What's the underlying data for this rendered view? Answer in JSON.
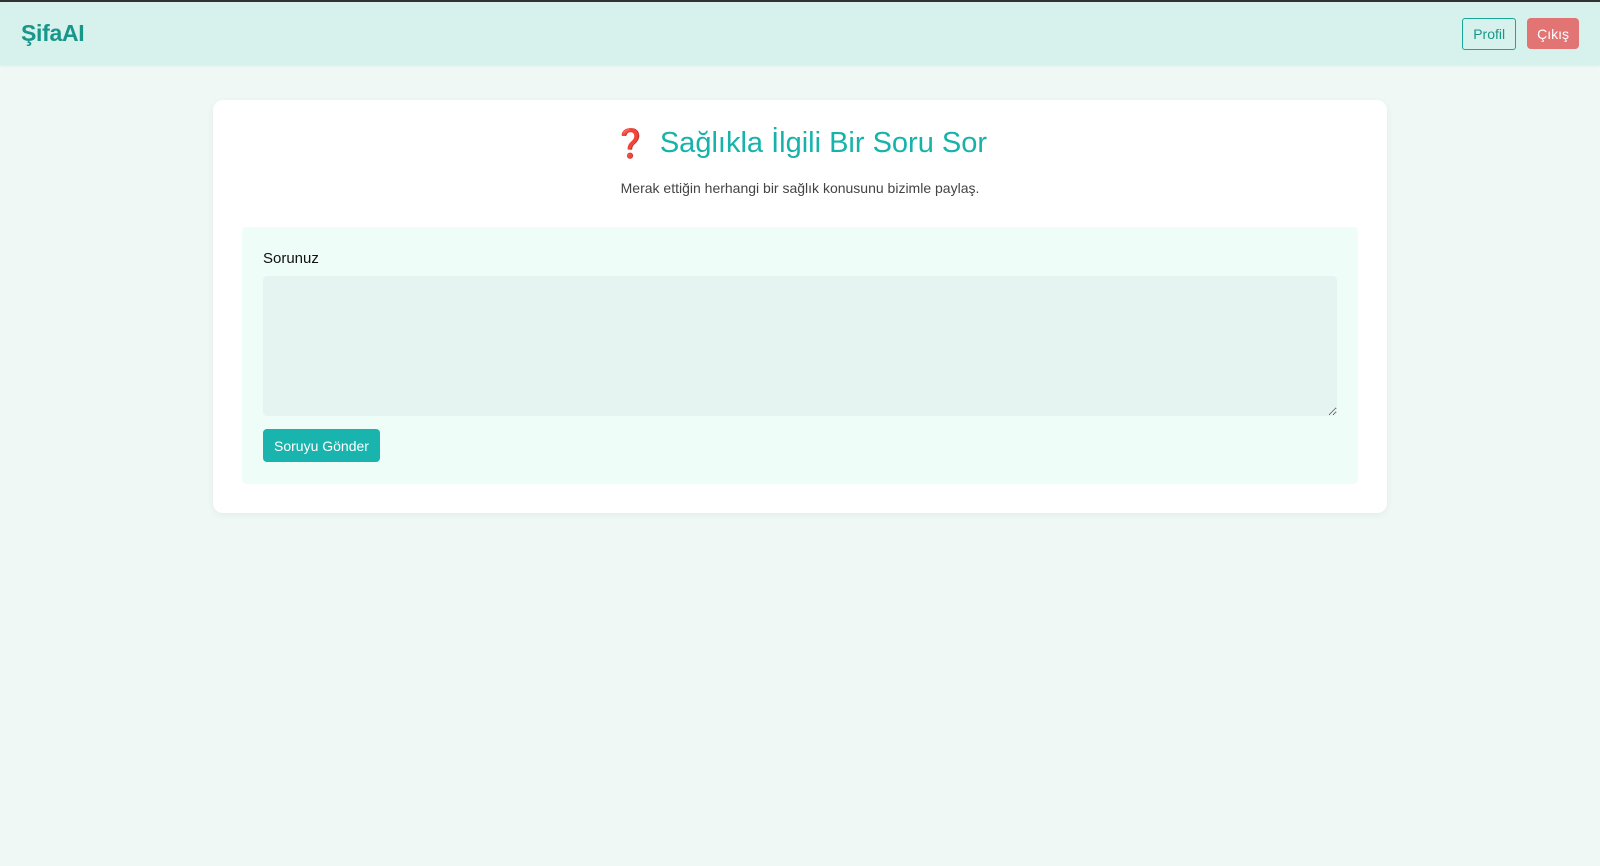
{
  "navbar": {
    "brand": "ŞifaAI",
    "profile_label": "Profil",
    "logout_label": "Çıkış"
  },
  "main": {
    "title_icon": "❓",
    "title": "Sağlıkla İlgili Bir Soru Sor",
    "subtitle": "Merak ettiğin herhangi bir sağlık konusunu bizimle paylaş.",
    "form": {
      "question_label": "Sorunuz",
      "question_value": "",
      "question_placeholder": "",
      "submit_label": "Soruyu Gönder"
    }
  },
  "colors": {
    "brand": "#17968a",
    "accent": "#19b4ad",
    "danger": "#e27474",
    "navbar_bg": "#d7f1ec",
    "page_bg": "#f0f8f6"
  },
  "icons": {
    "title_icon_name": "question-mark-icon"
  }
}
